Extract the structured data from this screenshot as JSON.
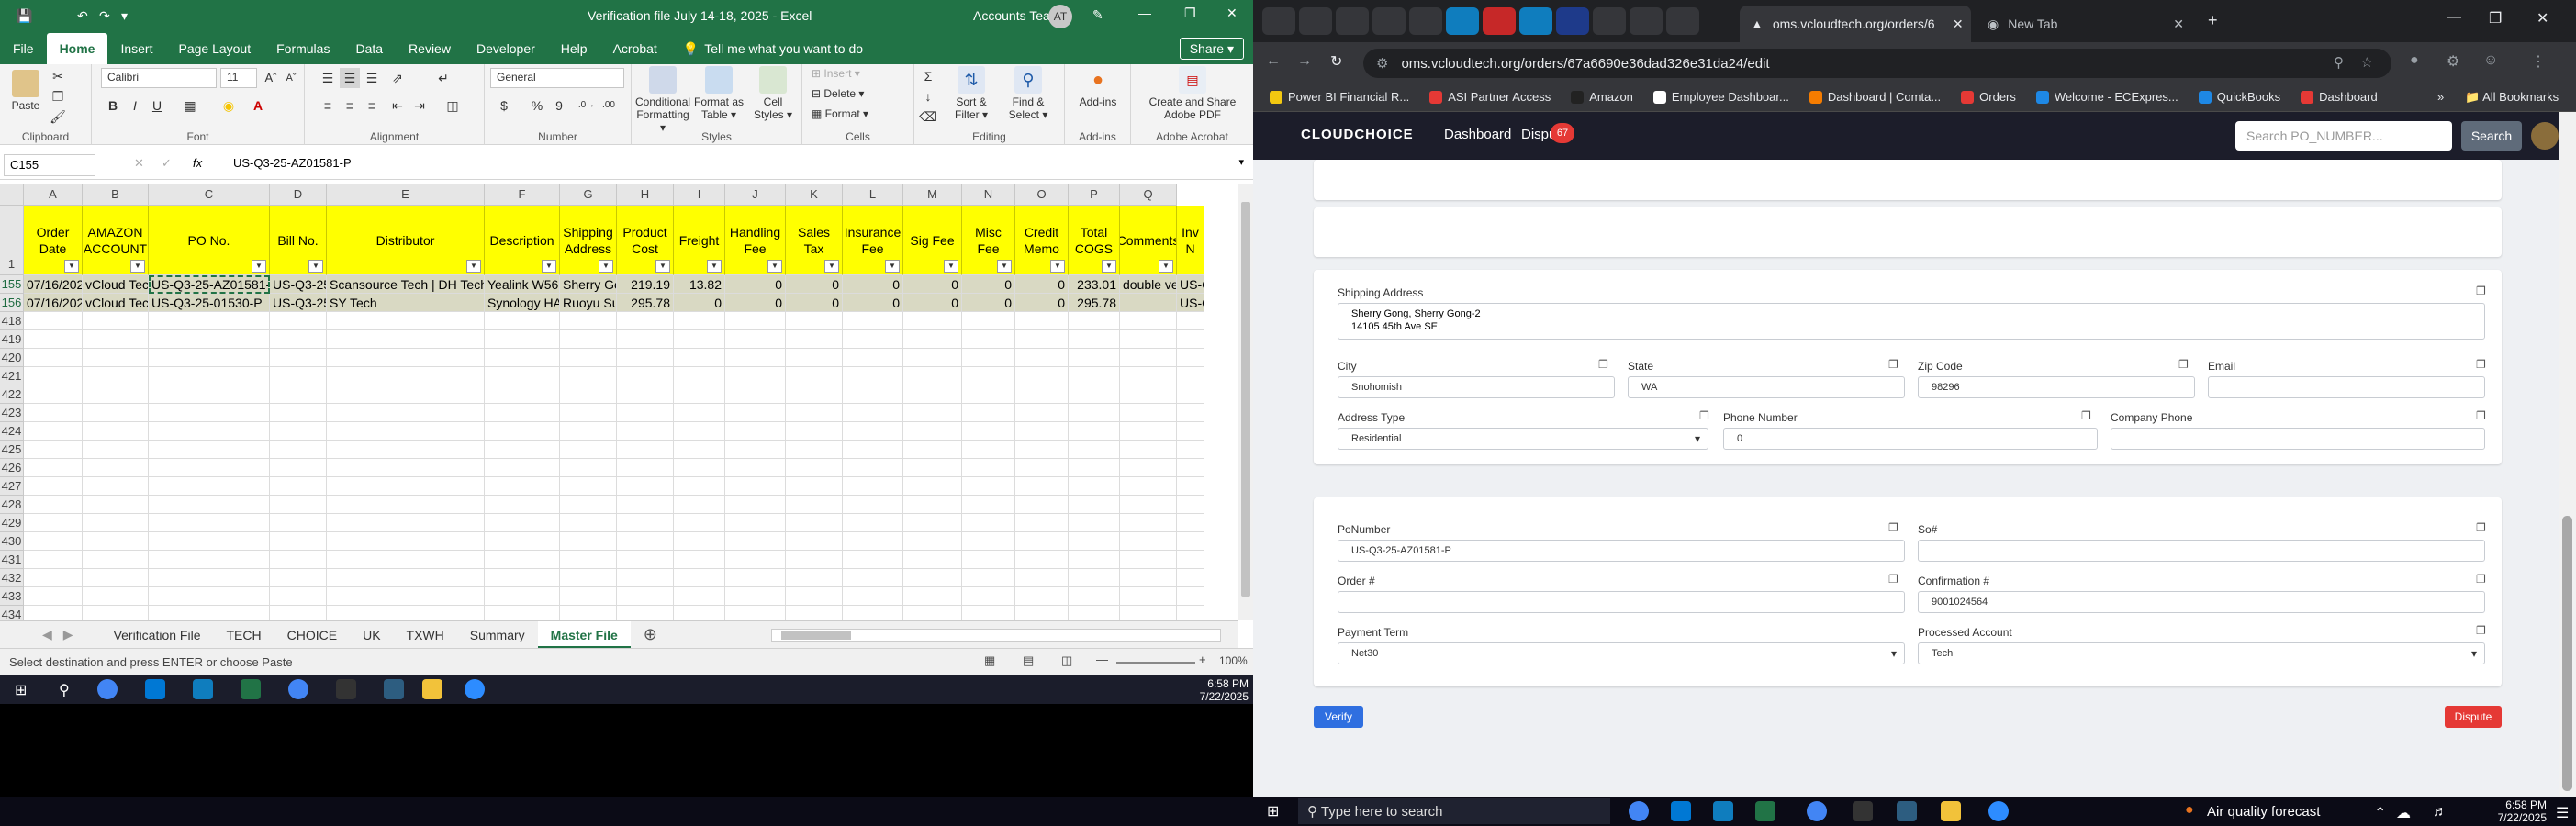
{
  "excel": {
    "title": "Verification file July 14-18, 2025 - Excel",
    "account": "Accounts Team",
    "avatar": "AT",
    "quick_access": [
      "↶",
      "↷",
      "▾"
    ],
    "menu_tabs": [
      "File",
      "Home",
      "Insert",
      "Page Layout",
      "Formulas",
      "Data",
      "Review",
      "Developer",
      "Help",
      "Acrobat"
    ],
    "tell_me": "Tell me what you want to do",
    "share": "Share",
    "ribbon": {
      "paste": "Paste",
      "clipboard": "Clipboard",
      "font_name": "Calibri",
      "font_size": "11",
      "font": "Font",
      "alignment": "Alignment",
      "number_format": "General",
      "number": "Number",
      "conditional": "Conditional Formatting ▾",
      "format_table": "Format as Table ▾",
      "cell_styles": "Cell Styles ▾",
      "styles": "Styles",
      "insert": "Insert",
      "delete": "Delete",
      "format": "Format",
      "cells": "Cells",
      "sort_filter": "Sort & Filter ▾",
      "find_select": "Find & Select ▾",
      "editing": "Editing",
      "addins": "Add-ins",
      "addins_group": "Add-ins",
      "create_pdf": "Create and Share Adobe PDF",
      "acrobat_group": "Adobe Acrobat",
      "bold": "B",
      "italic": "I",
      "underline": "U",
      "currency": "$",
      "percent": "%",
      "comma": "9"
    },
    "name_box": "C155",
    "formula": "US-Q3-25-AZ01581-P",
    "fx": "fx",
    "columns": [
      "A",
      "B",
      "C",
      "D",
      "E",
      "F",
      "G",
      "H",
      "I",
      "J",
      "K",
      "L",
      "M",
      "N",
      "O",
      "P",
      "Q"
    ],
    "headers": [
      "Order Date",
      "AMAZON ACCOUNT",
      "PO No.",
      "Bill No.",
      "Distributor",
      "Description",
      "Shipping Address",
      "Product Cost",
      "Freight",
      "Handling Fee",
      "Sales Tax",
      "Insurance Fee",
      "Sig Fee",
      "Misc Fee",
      "Credit Memo",
      "Total COGS",
      "Comments",
      "Inv N"
    ],
    "rows": [
      {
        "num": "155",
        "cells": [
          "07/16/202",
          "vCloud Tec",
          "US-Q3-25-AZ01581-P",
          "US-Q3-25-",
          "Scansource Tech | DH Tech",
          "Yealink W56",
          "Sherry Go",
          "219.19",
          "13.82",
          "0",
          "0",
          "0",
          "0",
          "0",
          "0",
          "233.01",
          "double ve",
          "US-C"
        ]
      },
      {
        "num": "156",
        "cells": [
          "07/16/202",
          "vCloud Tec",
          "US-Q3-25-01530-P",
          "US-Q3-25-",
          "SY Tech",
          "Synology HA",
          "Ruoyu Sur",
          "295.78",
          "0",
          "0",
          "0",
          "0",
          "0",
          "0",
          "0",
          "295.78",
          "",
          "US-C"
        ]
      }
    ],
    "empty_rows": [
      "418",
      "419",
      "420",
      "421",
      "422",
      "423",
      "424",
      "425",
      "426",
      "427",
      "428",
      "429",
      "430",
      "431",
      "432",
      "433",
      "434"
    ],
    "sheets": [
      "Verification File",
      "TECH",
      "CHOICE",
      "UK",
      "TXWH",
      "Summary",
      "Master File"
    ],
    "status": "Select destination and press ENTER or choose Paste",
    "zoom": "100%",
    "clock_time": "6:58 PM",
    "clock_date": "7/22/2025"
  },
  "chrome": {
    "active_tab": "oms.vcloudtech.org/orders/6",
    "new_tab": "New Tab",
    "url": "oms.vcloudtech.org/orders/67a6690e36dad326e31da24/edit",
    "bookmarks": [
      {
        "label": "Power BI Financial R...",
        "color": "#f2c811"
      },
      {
        "label": "ASI Partner Access",
        "color": "#e53935"
      },
      {
        "label": "Amazon",
        "color": "#222"
      },
      {
        "label": "Employee Dashboar...",
        "color": "#ffffff"
      },
      {
        "label": "Dashboard | Comta...",
        "color": "#f57c00"
      },
      {
        "label": "Orders",
        "color": "#e53935"
      },
      {
        "label": "Welcome - ECExpres...",
        "color": "#1e88e5"
      },
      {
        "label": "QuickBooks",
        "color": "#1e88e5"
      },
      {
        "label": "Dashboard",
        "color": "#e53935"
      }
    ],
    "all_bookmarks": "All Bookmarks"
  },
  "app": {
    "logo": "CLOUDCHOICE",
    "nav": [
      "Dashboard",
      "Dispu"
    ],
    "badge": "67",
    "search_placeholder": "Search PO_NUMBER...",
    "search_btn": "Search",
    "shipping_label": "Shipping Address",
    "shipping_value_1": "Sherry Gong, Sherry Gong-2",
    "shipping_value_2": "14105 45th Ave SE,",
    "city_label": "City",
    "city": "Snohomish",
    "state_label": "State",
    "state": "WA",
    "zip_label": "Zip Code",
    "zip": "98296",
    "email_label": "Email",
    "email": "",
    "addr_type_label": "Address Type",
    "addr_type": "Residential",
    "phone_label": "Phone Number",
    "phone": "0",
    "company_phone_label": "Company Phone",
    "company_phone": "",
    "po_label": "PoNumber",
    "po": "US-Q3-25-AZ01581-P",
    "so_label": "So#",
    "so": "",
    "order_label": "Order #",
    "order": "",
    "confirm_label": "Confirmation #",
    "confirm": "9001024564",
    "payment_label": "Payment Term",
    "payment": "Net30",
    "processed_label": "Processed Account",
    "processed": "Tech",
    "verify": "Verify",
    "dispute": "Dispute"
  },
  "taskbar": {
    "search": "Type here to search",
    "weather": "Air quality forecast",
    "time": "6:58 PM",
    "date": "7/22/2025"
  }
}
